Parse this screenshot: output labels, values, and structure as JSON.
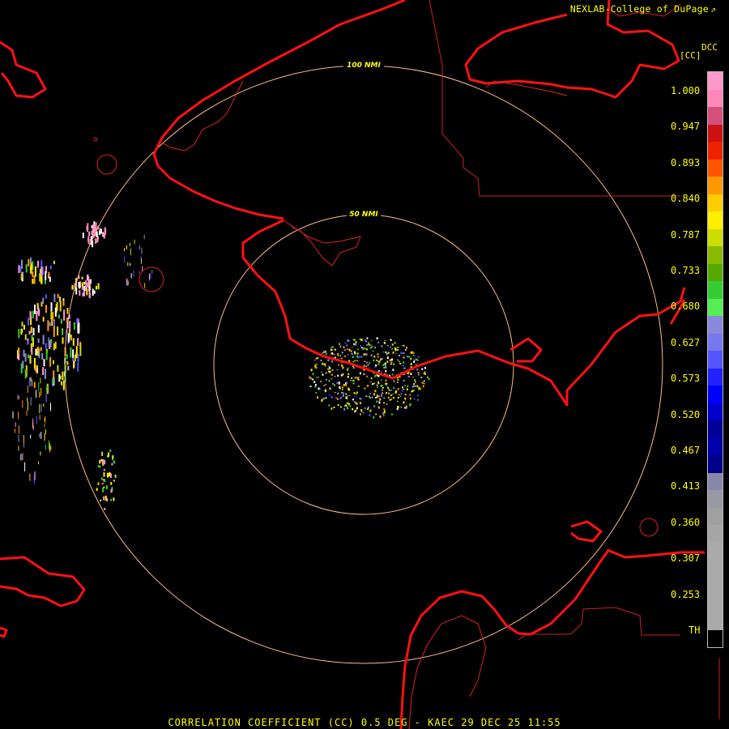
{
  "credit": "NEXLAB-College of DuPage",
  "credit_icon": "external-link-icon",
  "footer": "CORRELATION COEFFICIENT (CC) 0.5 DEG - KAEC 29 DEC 25 11:55",
  "legend": {
    "code": "DCC",
    "unit": "[CC]",
    "ticks": [
      "1.000",
      "0.947",
      "0.893",
      "0.840",
      "0.787",
      "0.733",
      "0.680",
      "0.627",
      "0.573",
      "0.520",
      "0.467",
      "0.413",
      "0.360",
      "0.307",
      "0.253",
      "TH"
    ],
    "colors": [
      "#ff99cc",
      "#ff88bb",
      "#d2507a",
      "#cc1111",
      "#ee2200",
      "#ff5500",
      "#ff9900",
      "#ffcc00",
      "#ffee00",
      "#ccdd00",
      "#88bb00",
      "#55aa00",
      "#33cc33",
      "#55ee55",
      "#8888dd",
      "#7777ee",
      "#5555ff",
      "#2222ff",
      "#0000ff",
      "#0000cc",
      "#000099",
      "#0000aa",
      "#000088",
      "#8888aa",
      "#9999a6",
      "#a0a0a0",
      "#a6a6a6",
      "#aaaaaa",
      "#aaaaaa",
      "#aaaaaa",
      "#aaaaaa",
      "#aaaaaa",
      "#000000"
    ]
  },
  "map": {
    "rings": [
      {
        "label": "50 NMI"
      },
      {
        "label": "100 NMI"
      }
    ],
    "ring_color": "#ffbb88",
    "coast_color": "#ff1111",
    "border_color": "#cc2222"
  }
}
